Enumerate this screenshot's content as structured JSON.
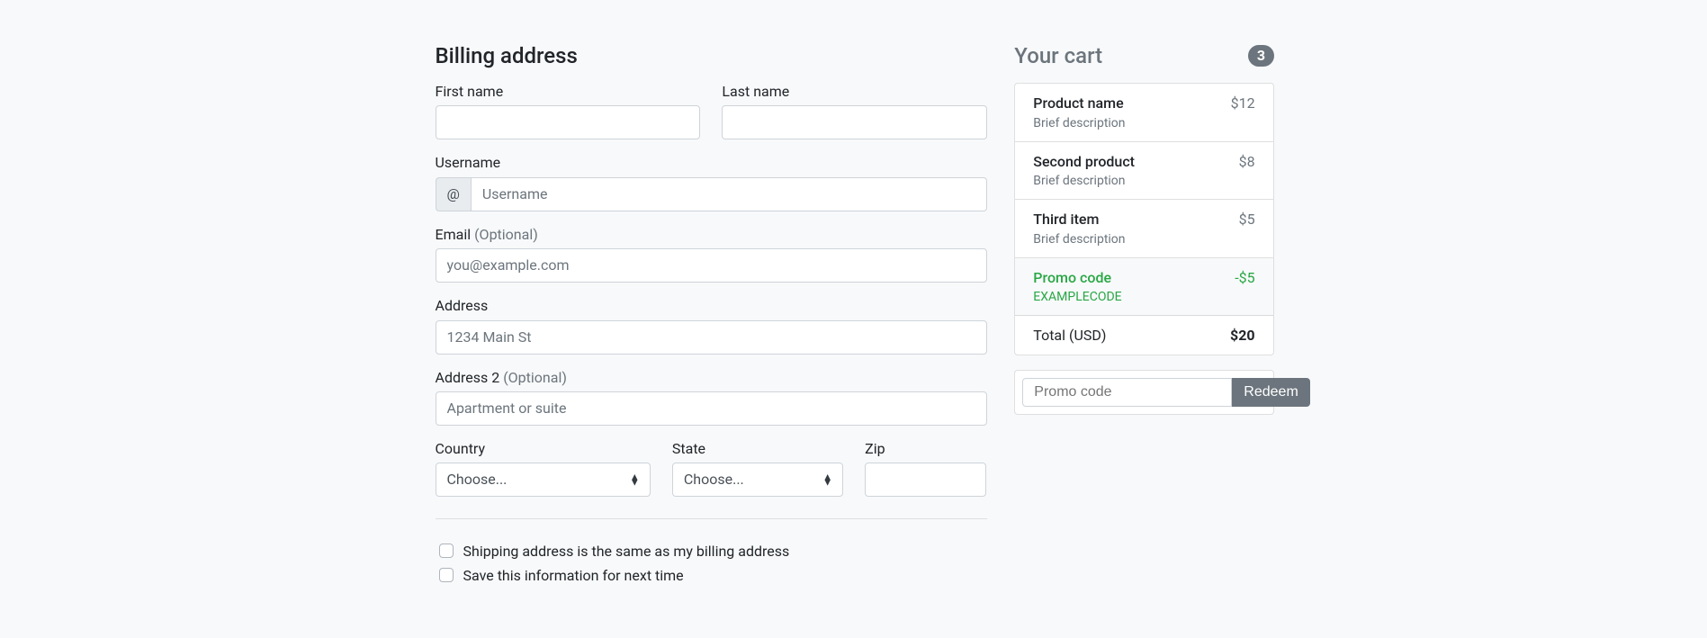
{
  "billing": {
    "heading": "Billing address",
    "firstNameLabel": "First name",
    "lastNameLabel": "Last name",
    "usernameLabel": "Username",
    "usernamePrefix": "@",
    "usernamePlaceholder": "Username",
    "emailLabel": "Email",
    "emailOptional": "(Optional)",
    "emailPlaceholder": "you@example.com",
    "addressLabel": "Address",
    "addressPlaceholder": "1234 Main St",
    "address2Label": "Address 2",
    "address2Optional": "(Optional)",
    "address2Placeholder": "Apartment or suite",
    "countryLabel": "Country",
    "countryPlaceholder": "Choose...",
    "stateLabel": "State",
    "statePlaceholder": "Choose...",
    "zipLabel": "Zip",
    "sameAddressLabel": "Shipping address is the same as my billing address",
    "saveInfoLabel": "Save this information for next time"
  },
  "cart": {
    "heading": "Your cart",
    "count": "3",
    "items": [
      {
        "name": "Product name",
        "desc": "Brief description",
        "price": "$12"
      },
      {
        "name": "Second product",
        "desc": "Brief description",
        "price": "$8"
      },
      {
        "name": "Third item",
        "desc": "Brief description",
        "price": "$5"
      }
    ],
    "promo": {
      "title": "Promo code",
      "code": "EXAMPLECODE",
      "amount": "-$5"
    },
    "totalLabel": "Total (USD)",
    "totalAmount": "$20",
    "promoPlaceholder": "Promo code",
    "redeemLabel": "Redeem"
  }
}
